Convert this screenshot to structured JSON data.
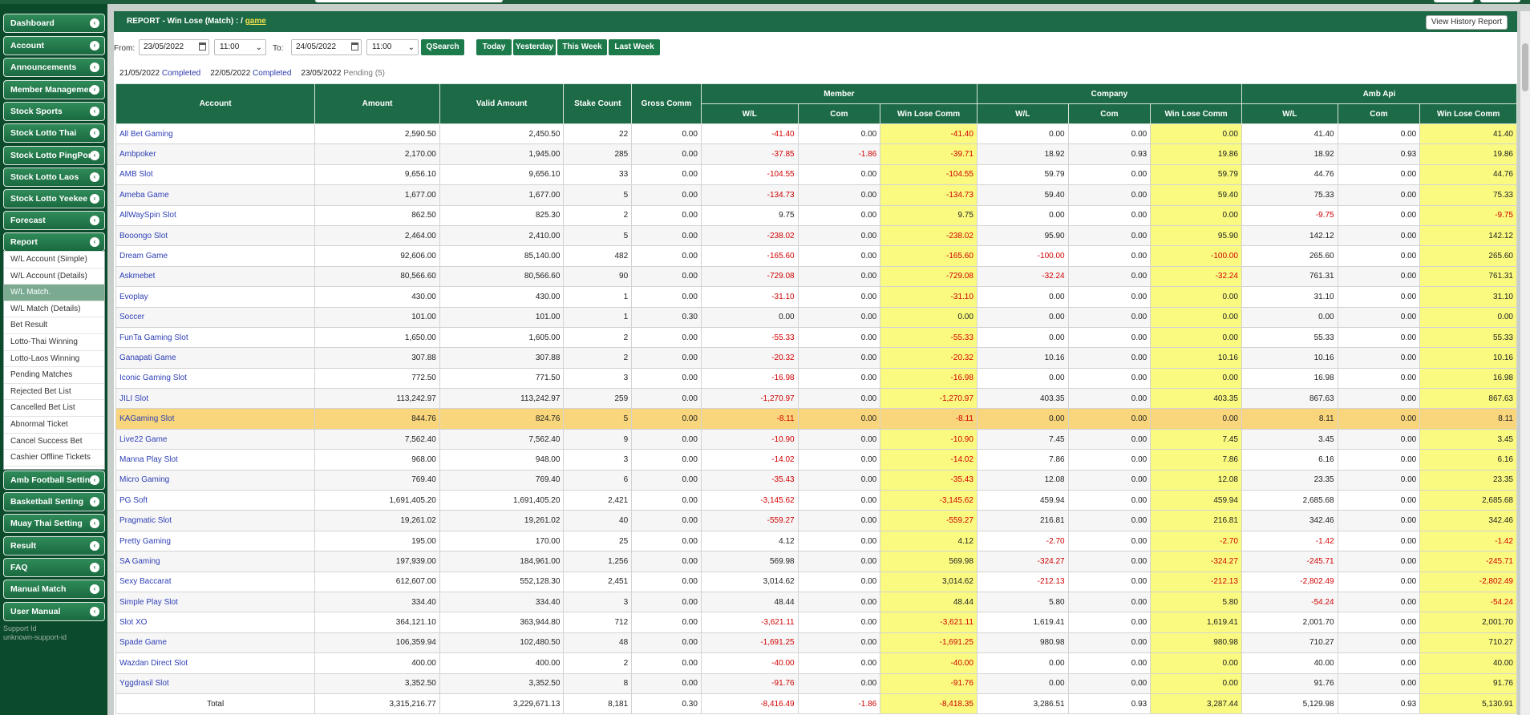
{
  "sidebar": {
    "items": [
      {
        "label": "Dashboard",
        "name": "sidebar-item-dashboard"
      },
      {
        "label": "Account",
        "name": "sidebar-item-account"
      },
      {
        "label": "Announcements",
        "name": "sidebar-item-announcements"
      },
      {
        "label": "Member Management",
        "name": "sidebar-item-member-management"
      },
      {
        "label": "Stock Sports",
        "name": "sidebar-item-stock-sports"
      },
      {
        "label": "Stock Lotto Thai",
        "name": "sidebar-item-stock-lotto-thai"
      },
      {
        "label": "Stock Lotto PingPong",
        "name": "sidebar-item-stock-lotto-pingpong"
      },
      {
        "label": "Stock Lotto Laos",
        "name": "sidebar-item-stock-lotto-laos"
      },
      {
        "label": "Stock Lotto Yeekee",
        "name": "sidebar-item-stock-lotto-yeekee"
      },
      {
        "label": "Forecast",
        "name": "sidebar-item-forecast"
      },
      {
        "label": "Report",
        "name": "sidebar-item-report"
      }
    ],
    "report_submenu": [
      "W/L Account (Simple)",
      "W/L Account (Details)",
      "W/L Match.",
      "W/L Match (Details)",
      "Bet Result",
      "Lotto-Thai Winning",
      "Lotto-Laos Winning",
      "Pending Matches",
      "Rejected Bet List",
      "Cancelled Bet List",
      "Abnormal Ticket",
      "Cancel Success Bet",
      "Cashier Offline Tickets"
    ],
    "active_submenu_index": 2,
    "items_after": [
      {
        "label": "Amb Football Setting",
        "name": "sidebar-item-amb-football-setting"
      },
      {
        "label": "Basketball Setting",
        "name": "sidebar-item-basketball-setting"
      },
      {
        "label": "Muay Thai Setting",
        "name": "sidebar-item-muay-thai-setting"
      },
      {
        "label": "Result",
        "name": "sidebar-item-result"
      },
      {
        "label": "FAQ",
        "name": "sidebar-item-faq"
      },
      {
        "label": "Manual Match",
        "name": "sidebar-item-manual-match"
      },
      {
        "label": "User Manual",
        "name": "sidebar-item-user-manual"
      }
    ],
    "support_label": "Support Id",
    "support_value": "unknown-support-id"
  },
  "report": {
    "title": "REPORT - Win Lose (Match) : /",
    "title_link": "game",
    "history_button": "View History Report"
  },
  "filters": {
    "from_label": "From:",
    "from_date": "23/05/2022",
    "from_time": "11:00",
    "to_label": "To:",
    "to_date": "24/05/2022",
    "to_time": "11:00",
    "qsearch": "QSearch",
    "today": "Today",
    "yesterday": "Yesterday",
    "this_week": "This Week",
    "last_week": "Last Week"
  },
  "status": [
    {
      "date": "21/05/2022",
      "state": "Completed"
    },
    {
      "date": "22/05/2022",
      "state": "Completed"
    },
    {
      "date": "23/05/2022",
      "state": "Pending (5)"
    }
  ],
  "table": {
    "headers": {
      "account": "Account",
      "amount": "Amount",
      "valid_amount": "Valid Amount",
      "stake_count": "Stake Count",
      "gross_comm": "Gross Comm",
      "member": "Member",
      "company": "Company",
      "amb_api": "Amb Api",
      "wl": "W/L",
      "com": "Com",
      "win_lose_comm": "Win Lose Comm"
    },
    "highlight_row_index": 14,
    "rows": [
      [
        "All Bet Gaming",
        "2,590.50",
        "2,450.50",
        "22",
        "0.00",
        "-41.40",
        "0.00",
        "-41.40",
        "0.00",
        "0.00",
        "0.00",
        "41.40",
        "0.00",
        "41.40"
      ],
      [
        "Ambpoker",
        "2,170.00",
        "1,945.00",
        "285",
        "0.00",
        "-37.85",
        "-1.86",
        "-39.71",
        "18.92",
        "0.93",
        "19.86",
        "18.92",
        "0.93",
        "19.86"
      ],
      [
        "AMB Slot",
        "9,656.10",
        "9,656.10",
        "33",
        "0.00",
        "-104.55",
        "0.00",
        "-104.55",
        "59.79",
        "0.00",
        "59.79",
        "44.76",
        "0.00",
        "44.76"
      ],
      [
        "Ameba Game",
        "1,677.00",
        "1,677.00",
        "5",
        "0.00",
        "-134.73",
        "0.00",
        "-134.73",
        "59.40",
        "0.00",
        "59.40",
        "75.33",
        "0.00",
        "75.33"
      ],
      [
        "AllWaySpin Slot",
        "862.50",
        "825.30",
        "2",
        "0.00",
        "9.75",
        "0.00",
        "9.75",
        "0.00",
        "0.00",
        "0.00",
        "-9.75",
        "0.00",
        "-9.75"
      ],
      [
        "Booongo Slot",
        "2,464.00",
        "2,410.00",
        "5",
        "0.00",
        "-238.02",
        "0.00",
        "-238.02",
        "95.90",
        "0.00",
        "95.90",
        "142.12",
        "0.00",
        "142.12"
      ],
      [
        "Dream Game",
        "92,606.00",
        "85,140.00",
        "482",
        "0.00",
        "-165.60",
        "0.00",
        "-165.60",
        "-100.00",
        "0.00",
        "-100.00",
        "265.60",
        "0.00",
        "265.60"
      ],
      [
        "Askmebet",
        "80,566.60",
        "80,566.60",
        "90",
        "0.00",
        "-729.08",
        "0.00",
        "-729.08",
        "-32.24",
        "0.00",
        "-32.24",
        "761.31",
        "0.00",
        "761.31"
      ],
      [
        "Evoplay",
        "430.00",
        "430.00",
        "1",
        "0.00",
        "-31.10",
        "0.00",
        "-31.10",
        "0.00",
        "0.00",
        "0.00",
        "31.10",
        "0.00",
        "31.10"
      ],
      [
        "Soccer",
        "101.00",
        "101.00",
        "1",
        "0.30",
        "0.00",
        "0.00",
        "0.00",
        "0.00",
        "0.00",
        "0.00",
        "0.00",
        "0.00",
        "0.00"
      ],
      [
        "FunTa Gaming Slot",
        "1,650.00",
        "1,605.00",
        "2",
        "0.00",
        "-55.33",
        "0.00",
        "-55.33",
        "0.00",
        "0.00",
        "0.00",
        "55.33",
        "0.00",
        "55.33"
      ],
      [
        "Ganapati Game",
        "307.88",
        "307.88",
        "2",
        "0.00",
        "-20.32",
        "0.00",
        "-20.32",
        "10.16",
        "0.00",
        "10.16",
        "10.16",
        "0.00",
        "10.16"
      ],
      [
        "Iconic Gaming Slot",
        "772.50",
        "771.50",
        "3",
        "0.00",
        "-16.98",
        "0.00",
        "-16.98",
        "0.00",
        "0.00",
        "0.00",
        "16.98",
        "0.00",
        "16.98"
      ],
      [
        "JILI Slot",
        "113,242.97",
        "113,242.97",
        "259",
        "0.00",
        "-1,270.97",
        "0.00",
        "-1,270.97",
        "403.35",
        "0.00",
        "403.35",
        "867.63",
        "0.00",
        "867.63"
      ],
      [
        "KAGaming Slot",
        "844.76",
        "824.76",
        "5",
        "0.00",
        "-8.11",
        "0.00",
        "-8.11",
        "0.00",
        "0.00",
        "0.00",
        "8.11",
        "0.00",
        "8.11"
      ],
      [
        "Live22 Game",
        "7,562.40",
        "7,562.40",
        "9",
        "0.00",
        "-10.90",
        "0.00",
        "-10.90",
        "7.45",
        "0.00",
        "7.45",
        "3.45",
        "0.00",
        "3.45"
      ],
      [
        "Manna Play Slot",
        "968.00",
        "948.00",
        "3",
        "0.00",
        "-14.02",
        "0.00",
        "-14.02",
        "7.86",
        "0.00",
        "7.86",
        "6.16",
        "0.00",
        "6.16"
      ],
      [
        "Micro Gaming",
        "769.40",
        "769.40",
        "6",
        "0.00",
        "-35.43",
        "0.00",
        "-35.43",
        "12.08",
        "0.00",
        "12.08",
        "23.35",
        "0.00",
        "23.35"
      ],
      [
        "PG Soft",
        "1,691,405.20",
        "1,691,405.20",
        "2,421",
        "0.00",
        "-3,145.62",
        "0.00",
        "-3,145.62",
        "459.94",
        "0.00",
        "459.94",
        "2,685.68",
        "0.00",
        "2,685.68"
      ],
      [
        "Pragmatic Slot",
        "19,261.02",
        "19,261.02",
        "40",
        "0.00",
        "-559.27",
        "0.00",
        "-559.27",
        "216.81",
        "0.00",
        "216.81",
        "342.46",
        "0.00",
        "342.46"
      ],
      [
        "Pretty Gaming",
        "195.00",
        "170.00",
        "25",
        "0.00",
        "4.12",
        "0.00",
        "4.12",
        "-2.70",
        "0.00",
        "-2.70",
        "-1.42",
        "0.00",
        "-1.42"
      ],
      [
        "SA Gaming",
        "197,939.00",
        "184,961.00",
        "1,256",
        "0.00",
        "569.98",
        "0.00",
        "569.98",
        "-324.27",
        "0.00",
        "-324.27",
        "-245.71",
        "0.00",
        "-245.71"
      ],
      [
        "Sexy Baccarat",
        "612,607.00",
        "552,128.30",
        "2,451",
        "0.00",
        "3,014.62",
        "0.00",
        "3,014.62",
        "-212.13",
        "0.00",
        "-212.13",
        "-2,802.49",
        "0.00",
        "-2,802.49"
      ],
      [
        "Simple Play Slot",
        "334.40",
        "334.40",
        "3",
        "0.00",
        "48.44",
        "0.00",
        "48.44",
        "5.80",
        "0.00",
        "5.80",
        "-54.24",
        "0.00",
        "-54.24"
      ],
      [
        "Slot XO",
        "364,121.10",
        "363,944.80",
        "712",
        "0.00",
        "-3,621.11",
        "0.00",
        "-3,621.11",
        "1,619.41",
        "0.00",
        "1,619.41",
        "2,001.70",
        "0.00",
        "2,001.70"
      ],
      [
        "Spade Game",
        "106,359.94",
        "102,480.50",
        "48",
        "0.00",
        "-1,691.25",
        "0.00",
        "-1,691.25",
        "980.98",
        "0.00",
        "980.98",
        "710.27",
        "0.00",
        "710.27"
      ],
      [
        "Wazdan Direct Slot",
        "400.00",
        "400.00",
        "2",
        "0.00",
        "-40.00",
        "0.00",
        "-40.00",
        "0.00",
        "0.00",
        "0.00",
        "40.00",
        "0.00",
        "40.00"
      ],
      [
        "Yggdrasil Slot",
        "3,352.50",
        "3,352.50",
        "8",
        "0.00",
        "-91.76",
        "0.00",
        "-91.76",
        "0.00",
        "0.00",
        "0.00",
        "91.76",
        "0.00",
        "91.76"
      ]
    ],
    "total": [
      "Total",
      "3,315,216.77",
      "3,229,671.13",
      "8,181",
      "0.30",
      "-8,416.49",
      "-1.86",
      "-8,418.35",
      "3,286.51",
      "0.93",
      "3,287.44",
      "5,129.98",
      "0.93",
      "5,130.91"
    ]
  },
  "colors": {
    "header_green": "#1d6b46",
    "highlight_yellow": "#fafa80",
    "selected_row": "#f9d67c",
    "negative_red": "#d00000",
    "link_blue": "#2d3fb5"
  }
}
